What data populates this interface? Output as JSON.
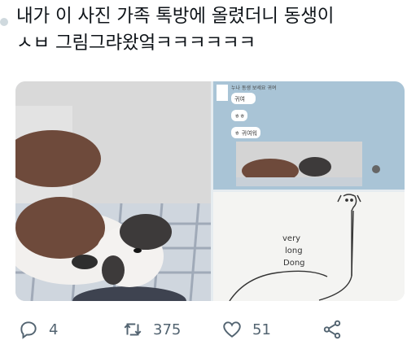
{
  "tweet": {
    "line1": "내가 이 사진 가족 톡방에 올렸더니 동생이",
    "line2": "ㅅㅂ 그림그랴왔엌ㅋㅋㅋㅋㅋㅋ"
  },
  "media": {
    "chat": {
      "header": "누나 동생 보세요 귀여",
      "bubbles": [
        "귀여",
        "ㅎㅎ",
        "ㅎ 귀여워"
      ]
    },
    "drawing": {
      "line1": "very",
      "line2": "long",
      "line3": "Dong"
    }
  },
  "actions": {
    "reply_count": "4",
    "retweet_count": "375",
    "like_count": "51"
  },
  "colors": {
    "icon": "#536471",
    "chat_bg": "#a9c4d6"
  }
}
